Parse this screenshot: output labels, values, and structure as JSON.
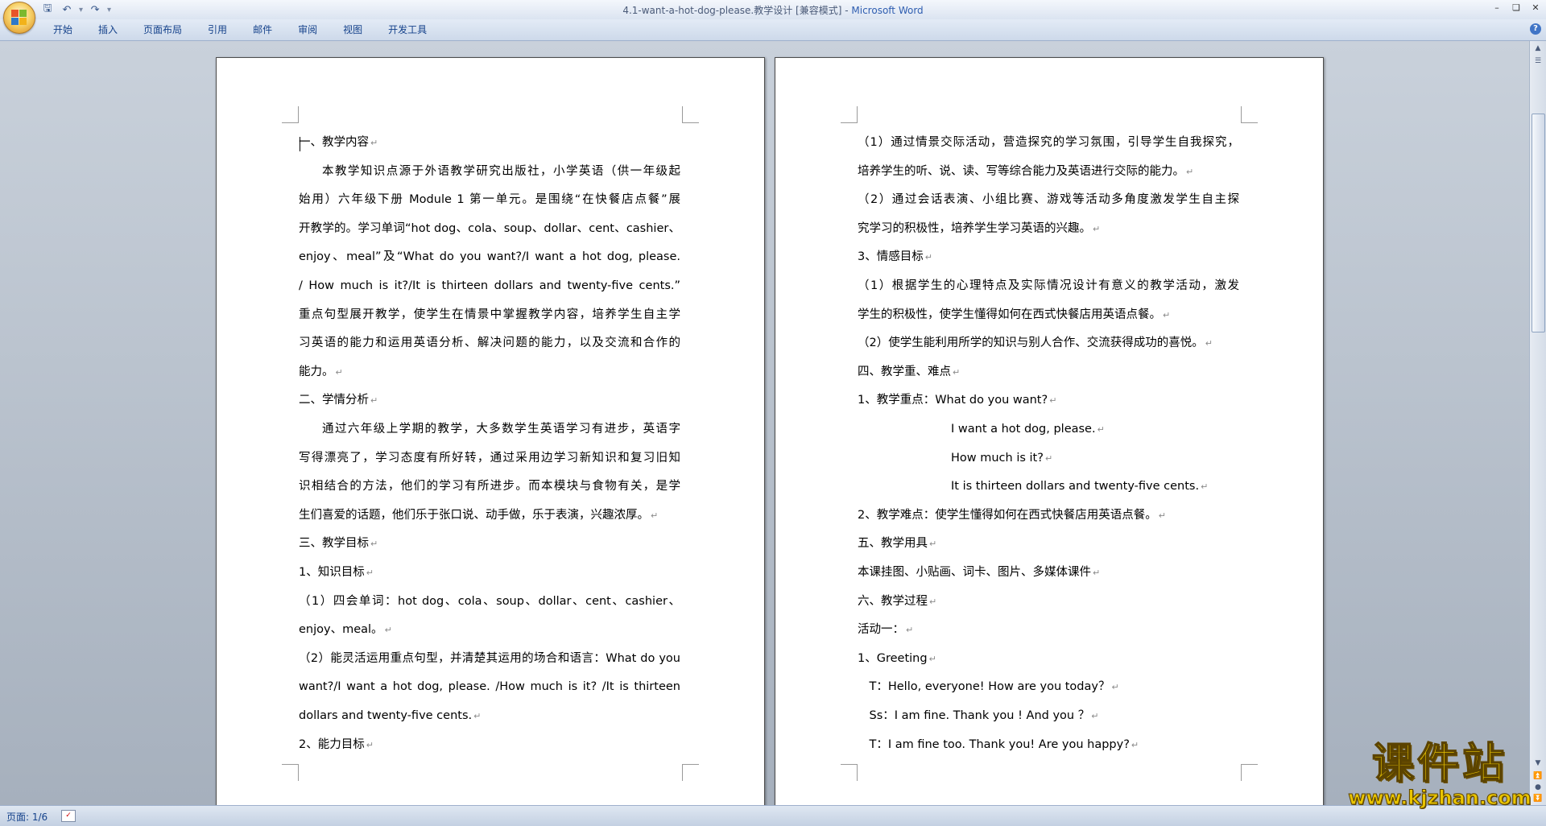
{
  "window": {
    "title": "4.1-want-a-hot-dog-please.教学设计 [兼容模式] - ",
    "app_name": "Microsoft Word"
  },
  "quick_access": {
    "icons": [
      "save-icon",
      "undo-icon",
      "redo-icon",
      "customize-icon"
    ]
  },
  "ribbon": {
    "tabs": [
      "开始",
      "插入",
      "页面布局",
      "引用",
      "邮件",
      "审阅",
      "视图",
      "开发工具"
    ]
  },
  "pages": [
    {
      "lines": [
        {
          "text": "一、教学内容",
          "indent": 0,
          "justify": false
        },
        {
          "text": "本教学知识点源于外语教学研究出版社，小学英语（供一年级起",
          "indent": 1,
          "justify": true
        },
        {
          "text": "始用）六年级下册 Module 1 第一单元。是围绕“在快餐店点餐”展",
          "indent": 0,
          "justify": true
        },
        {
          "text": "开教学的。学习单词“hot dog、cola、soup、dollar、cent、cashier、",
          "indent": 0,
          "justify": true
        },
        {
          "text": "enjoy、meal”及“What do you want?/I want a hot dog, please.",
          "indent": 0,
          "justify": true
        },
        {
          "text": "/ How much is it?/It is thirteen dollars and twenty-five cents.”",
          "indent": 0,
          "justify": true
        },
        {
          "text": "重点句型展开教学，使学生在情景中掌握教学内容，培养学生自主学",
          "indent": 0,
          "justify": true
        },
        {
          "text": "习英语的能力和运用英语分析、解决问题的能力，以及交流和合作的",
          "indent": 0,
          "justify": true
        },
        {
          "text": "能力。",
          "indent": 0,
          "justify": false
        },
        {
          "text": "二、学情分析",
          "indent": 0,
          "justify": false
        },
        {
          "text": "通过六年级上学期的教学，大多数学生英语学习有进步，英语字",
          "indent": 1,
          "justify": true
        },
        {
          "text": "写得漂亮了，学习态度有所好转，通过采用边学习新知识和复习旧知",
          "indent": 0,
          "justify": true
        },
        {
          "text": "识相结合的方法，他们的学习有所进步。而本模块与食物有关，是学",
          "indent": 0,
          "justify": true
        },
        {
          "text": "生们喜爱的话题，他们乐于张口说、动手做，乐于表演，兴趣浓厚。",
          "indent": 0,
          "justify": false
        },
        {
          "text": "三、教学目标",
          "indent": 0,
          "justify": false
        },
        {
          "text": "1、知识目标",
          "indent": 0,
          "justify": false
        },
        {
          "text": "（1）四会单词：hot dog、cola、soup、dollar、cent、cashier、",
          "indent": 0,
          "justify": true
        },
        {
          "text": "enjoy、meal。",
          "indent": 0,
          "justify": false
        },
        {
          "text": "（2）能灵活运用重点句型，并清楚其运用的场合和语言：What do you",
          "indent": 0,
          "justify": true
        },
        {
          "text": "want?/I want a hot dog, please. /How much is it? /It is thirteen",
          "indent": 0,
          "justify": true
        },
        {
          "text": "dollars and twenty-five cents.",
          "indent": 0,
          "justify": false
        },
        {
          "text": "2、能力目标",
          "indent": 0,
          "justify": false
        }
      ]
    },
    {
      "lines": [
        {
          "text": "（1）通过情景交际活动，营造探究的学习氛围，引导学生自我探究，",
          "indent": 0,
          "justify": true
        },
        {
          "text": "培养学生的听、说、读、写等综合能力及英语进行交际的能力。",
          "indent": 0,
          "justify": false
        },
        {
          "text": "（2）通过会话表演、小组比赛、游戏等活动多角度激发学生自主探",
          "indent": 0,
          "justify": true
        },
        {
          "text": "究学习的积极性，培养学生学习英语的兴趣。",
          "indent": 0,
          "justify": false
        },
        {
          "text": "3、情感目标",
          "indent": 0,
          "justify": false
        },
        {
          "text": "（1）根据学生的心理特点及实际情况设计有意义的教学活动，激发",
          "indent": 0,
          "justify": true
        },
        {
          "text": "学生的积极性，使学生懂得如何在西式快餐店用英语点餐。",
          "indent": 0,
          "justify": false
        },
        {
          "text": "（2）使学生能利用所学的知识与别人合作、交流获得成功的喜悦。",
          "indent": 0,
          "justify": false
        },
        {
          "text": "四、教学重、难点",
          "indent": 0,
          "justify": false
        },
        {
          "text": "1、教学重点：What do you want?",
          "indent": 0,
          "justify": false
        },
        {
          "text": "I want a hot dog, please.",
          "indent": 4,
          "justify": false
        },
        {
          "text": "How much is it?",
          "indent": 4,
          "justify": false
        },
        {
          "text": "It is thirteen dollars and twenty-five cents.",
          "indent": 4,
          "justify": false
        },
        {
          "text": "2、教学难点：使学生懂得如何在西式快餐店用英语点餐。",
          "indent": 0,
          "justify": false
        },
        {
          "text": "五、教学用具",
          "indent": 0,
          "justify": false
        },
        {
          "text": "本课挂图、小贴画、词卡、图片、多媒体课件",
          "indent": 0,
          "justify": false
        },
        {
          "text": "六、教学过程",
          "indent": 0,
          "justify": false
        },
        {
          "text": "活动一：",
          "indent": 0,
          "justify": false
        },
        {
          "text": "1、Greeting",
          "indent": 0,
          "justify": false
        },
        {
          "text": "T：Hello, everyone! How are you today？",
          "indent": 0.5,
          "justify": false
        },
        {
          "text": "Ss：I am fine. Thank you ! And you ？",
          "indent": 0.5,
          "justify": false
        },
        {
          "text": "T：I am fine too. Thank you! Are you happy?",
          "indent": 0.5,
          "justify": false
        }
      ]
    }
  ],
  "paragraph_mark": "↵",
  "status": {
    "page_count": "页面: 1/6"
  },
  "watermark": {
    "cn": "课件站",
    "url": "www.kjzhan.com"
  }
}
